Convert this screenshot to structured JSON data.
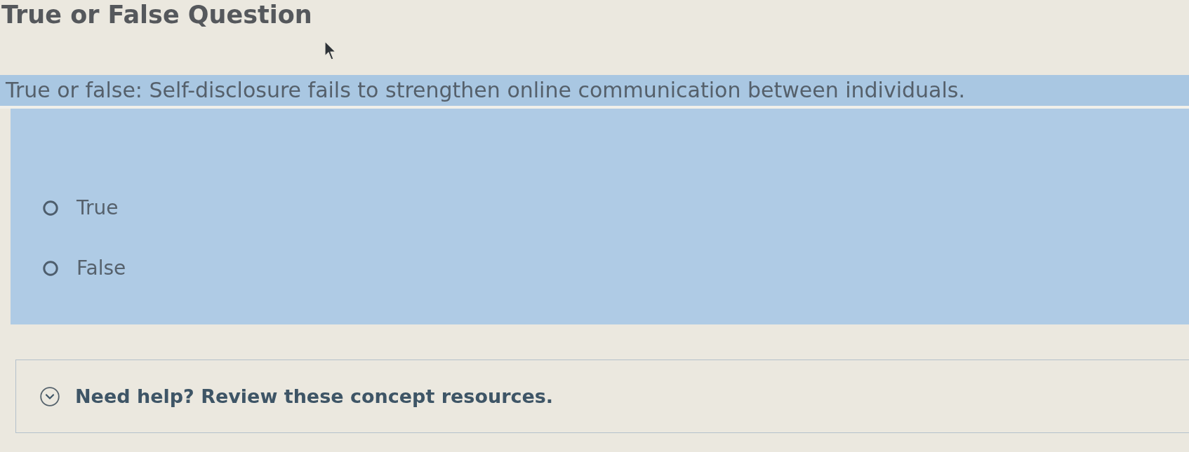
{
  "heading": {
    "title": "True or False Question"
  },
  "question": {
    "prompt": "True or false: Self-disclosure fails to strengthen online communication between individuals."
  },
  "options": [
    {
      "label": "True",
      "selected": false
    },
    {
      "label": "False",
      "selected": false
    }
  ],
  "help": {
    "label": "Need help? Review these concept resources.",
    "expanded": false
  }
}
